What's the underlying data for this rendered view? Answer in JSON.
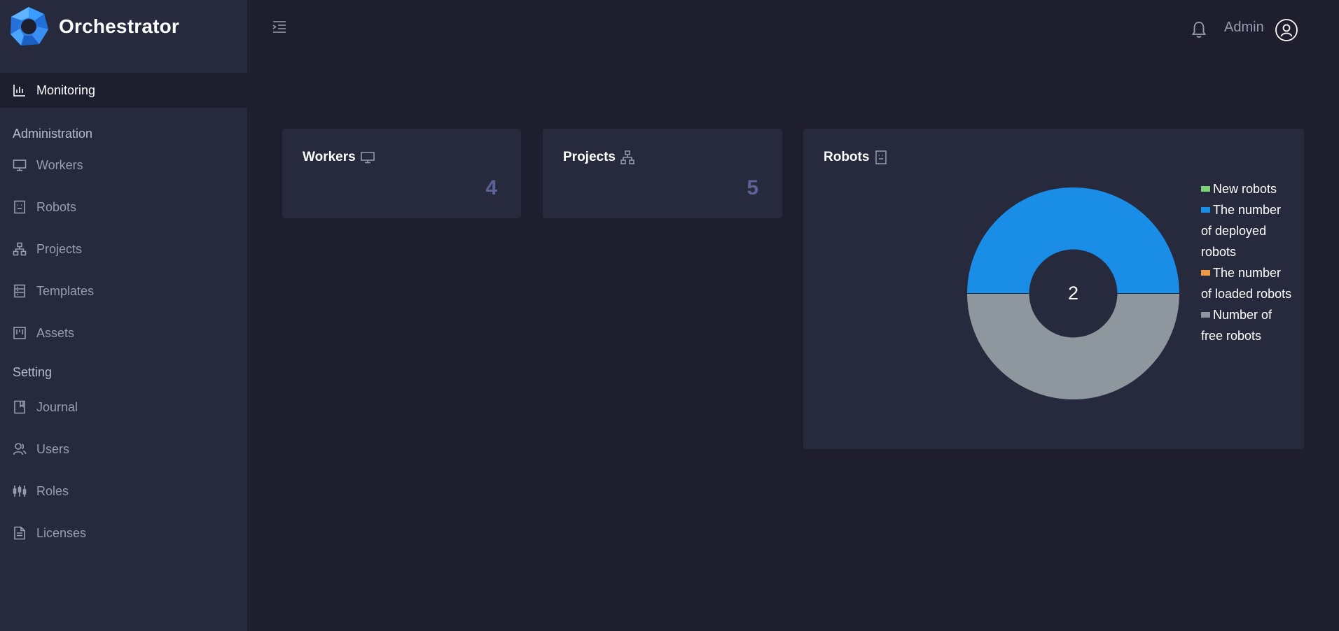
{
  "app": {
    "name": "Orchestrator"
  },
  "sidebar": {
    "active": {
      "label": "Monitoring",
      "icon": "bar-chart-icon"
    },
    "sections": [
      {
        "title": "Administration",
        "items": [
          {
            "label": "Workers",
            "icon": "monitor-icon"
          },
          {
            "label": "Robots",
            "icon": "robot-icon"
          },
          {
            "label": "Projects",
            "icon": "hierarchy-icon"
          },
          {
            "label": "Templates",
            "icon": "template-icon"
          },
          {
            "label": "Assets",
            "icon": "assets-icon"
          }
        ]
      },
      {
        "title": "Setting",
        "items": [
          {
            "label": "Journal",
            "icon": "book-icon"
          },
          {
            "label": "Users",
            "icon": "users-icon"
          },
          {
            "label": "Roles",
            "icon": "roles-icon"
          },
          {
            "label": "Licenses",
            "icon": "document-icon"
          }
        ]
      }
    ]
  },
  "header": {
    "user_name": "Admin"
  },
  "cards": {
    "workers": {
      "title": "Workers",
      "value": "4"
    },
    "projects": {
      "title": "Projects",
      "value": "5"
    },
    "robots": {
      "title": "Robots",
      "center_value": "2",
      "legend": [
        {
          "label": "New robots",
          "color": "#7fd17a",
          "value": 0
        },
        {
          "label": "The number of deployed robots",
          "color": "#1a8ee6",
          "value": 1
        },
        {
          "label": "The number of loaded robots",
          "color": "#f09a45",
          "value": 0
        },
        {
          "label": "Number of free robots",
          "color": "#8f979e",
          "value": 1
        }
      ]
    }
  },
  "colors": {
    "background": "#1e1e2f",
    "panel": "#27293d",
    "accent_value": "#5b6394"
  }
}
